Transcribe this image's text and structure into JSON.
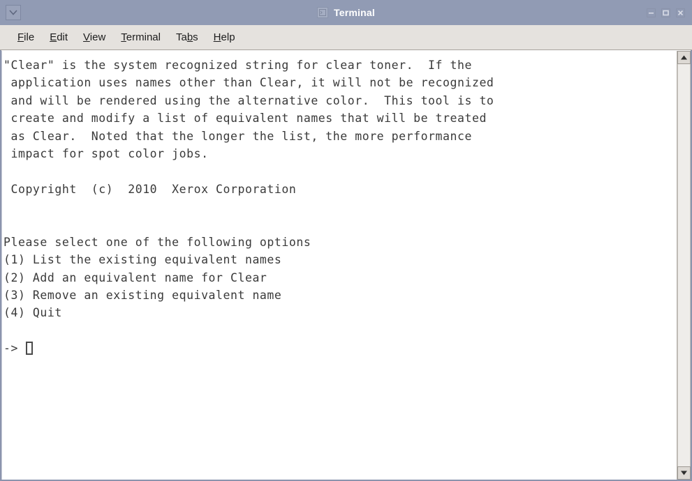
{
  "window": {
    "title": "Terminal",
    "window_menu_icon": "chevron-down-icon",
    "title_icon": "terminal-icon",
    "controls": {
      "minimize": "minimize-icon",
      "maximize": "maximize-icon",
      "close": "close-icon"
    },
    "colors": {
      "titlebar": "#919bb4",
      "menubar": "#e5e2de",
      "terminal_bg": "#ffffff",
      "terminal_fg": "#3a3a3a",
      "border": "#8b94ad"
    }
  },
  "menubar": {
    "items": [
      {
        "label": "File",
        "mnemonic": "F"
      },
      {
        "label": "Edit",
        "mnemonic": "E"
      },
      {
        "label": "View",
        "mnemonic": "V"
      },
      {
        "label": "Terminal",
        "mnemonic": "T"
      },
      {
        "label": "Tabs",
        "mnemonic": "b"
      },
      {
        "label": "Help",
        "mnemonic": "H"
      }
    ]
  },
  "terminal": {
    "lines": [
      "\"Clear\" is the system recognized string for clear toner.  If the",
      " application uses names other than Clear, it will not be recognized",
      " and will be rendered using the alternative color.  This tool is to",
      " create and modify a list of equivalent names that will be treated",
      " as Clear.  Noted that the longer the list, the more performance",
      " impact for spot color jobs.",
      "",
      " Copyright  (c)  2010  Xerox Corporation",
      "",
      "",
      "Please select one of the following options",
      "(1) List the existing equivalent names",
      "(2) Add an equivalent name for Clear",
      "(3) Remove an existing equivalent name",
      "(4) Quit",
      ""
    ],
    "prompt": "-> ",
    "cursor": "block-cursor"
  },
  "scrollbar": {
    "up_arrow": "triangle-up-icon",
    "down_arrow": "triangle-down-icon",
    "thumb": "scrollbar-thumb"
  }
}
